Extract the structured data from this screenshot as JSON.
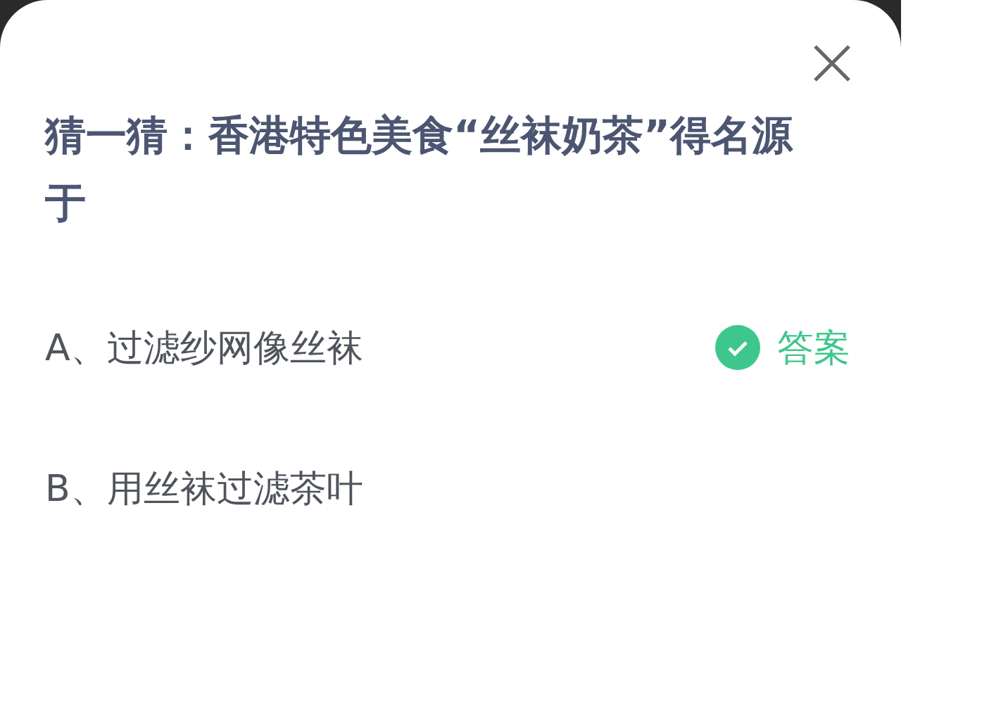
{
  "question": {
    "title": "猜一猜：香港特色美食“丝袜奶茶”得名源于",
    "answer_label": "答案"
  },
  "options": [
    {
      "text": "A、过滤纱网像丝袜",
      "correct": true
    },
    {
      "text": "B、用丝袜过滤茶叶",
      "correct": false
    }
  ]
}
